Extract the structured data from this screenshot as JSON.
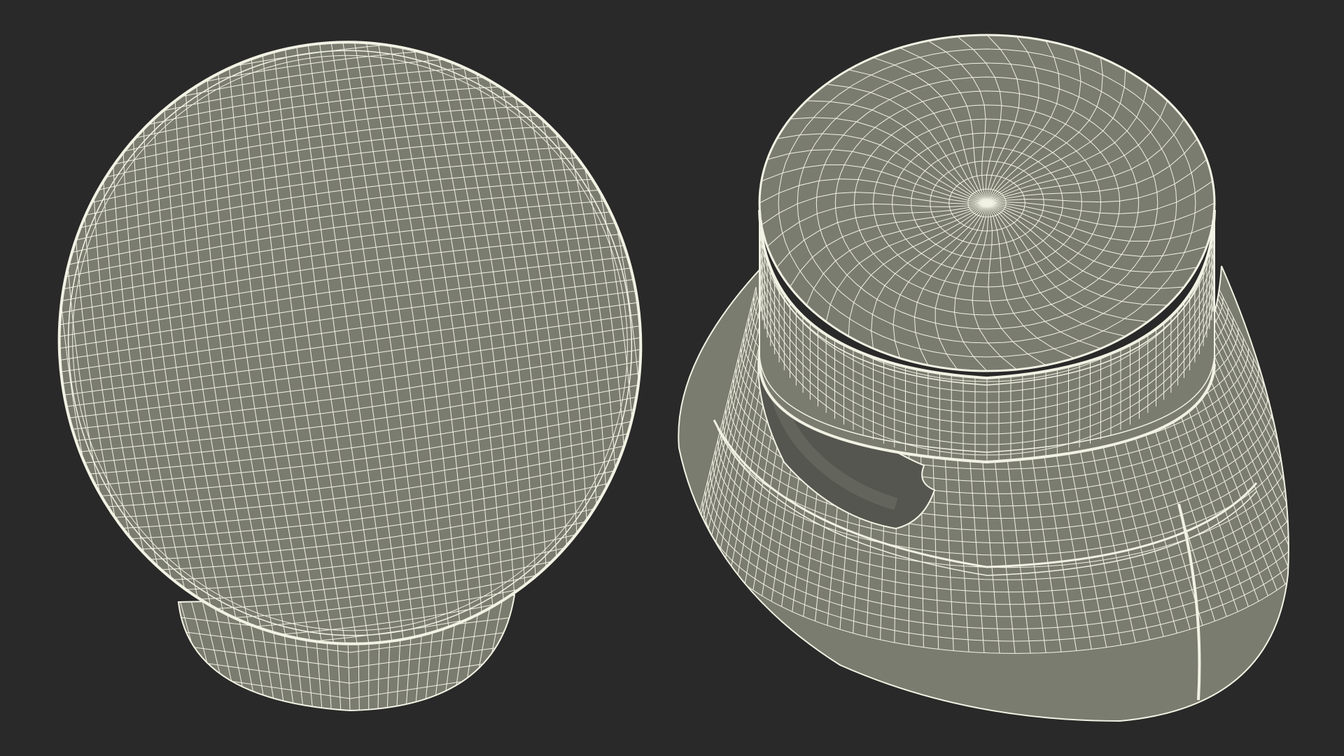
{
  "scene": {
    "background": "#292929",
    "mesh_fill": "#7b7c70",
    "mesh_fill_dark": "#5c5d54",
    "mesh_cavity": "#4f504a",
    "wire_color": "#f2f2e4",
    "views": [
      {
        "name": "earbud-top-view",
        "description_icon": "wireframe-disc-icon"
      },
      {
        "name": "earbud-perspective-view",
        "description_icon": "wireframe-capsule-icon"
      }
    ]
  }
}
